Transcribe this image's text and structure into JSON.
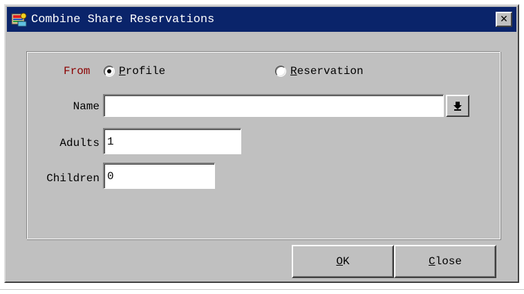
{
  "window": {
    "title": "Combine Share Reservations",
    "close_glyph": "✕",
    "icon": "app-icon"
  },
  "form": {
    "from_label": "From",
    "radio_profile": {
      "access_key": "P",
      "rest": "rofile",
      "selected": true
    },
    "radio_reservation": {
      "access_key": "R",
      "rest": "eservation",
      "selected": false
    },
    "name_label": "Name",
    "name_value": "",
    "adults_label": "Adults",
    "adults_value": "1",
    "children_label": "Children",
    "children_value": "0"
  },
  "buttons": {
    "ok": {
      "access_key": "O",
      "rest": "K"
    },
    "close": {
      "access_key": "C",
      "rest": "lose"
    }
  },
  "colors": {
    "titlebar": "#0a246a",
    "from_label": "#8b0000",
    "face": "#c0c0c0"
  }
}
